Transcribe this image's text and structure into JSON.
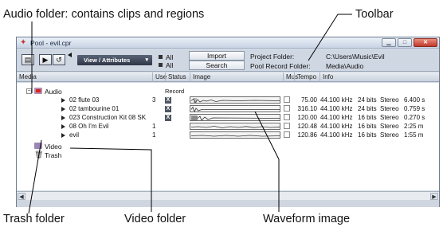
{
  "callouts": {
    "audio_folder": "Audio folder: contains clips and regions",
    "toolbar": "Toolbar",
    "trash_folder": "Trash folder",
    "video_folder": "Video folder",
    "waveform_image": "Waveform image"
  },
  "window": {
    "title": "Pool - evil.cpr",
    "buttons": {
      "minimize": "▁",
      "maximize": "□",
      "close": "✕"
    }
  },
  "toolbar": {
    "view_select": "View / Attributes",
    "all_1": "All",
    "all_2": "All",
    "import_button": "Import",
    "search_button": "Search",
    "project_folder_label": "Project Folder:",
    "project_folder_value": "C:\\Users\\Music\\Evil",
    "record_folder_label": "Pool Record Folder:",
    "record_folder_value": "Media\\Audio"
  },
  "columns": [
    "Media",
    "Use",
    "Status",
    "Image",
    "Mus",
    "Tempo",
    "Info"
  ],
  "tree": {
    "audio": {
      "label": "Audio",
      "status_header": "Record"
    },
    "video": {
      "label": "Video"
    },
    "trash": {
      "label": "Trash"
    }
  },
  "clips": [
    {
      "name": "02 flute 03",
      "use": "3",
      "status": "X",
      "tempo": "75.00",
      "rate": "44.100 kHz",
      "bits": "24 bits",
      "channels": "Stereo",
      "length": "6.400 s"
    },
    {
      "name": "02 tambourine 01",
      "use": "",
      "status": "X",
      "tempo": "316.10",
      "rate": "44.100 kHz",
      "bits": "24 bits",
      "channels": "Stereo",
      "length": "0.759 s"
    },
    {
      "name": "023 Construction Kit 08 SK",
      "use": "",
      "status": "X",
      "tempo": "120.00",
      "rate": "44.100 kHz",
      "bits": "16 bits",
      "channels": "Stereo",
      "length": "0.270 s"
    },
    {
      "name": "08 Oh I'm Evil",
      "use": "1",
      "status": "",
      "tempo": "120.48",
      "rate": "44.100 kHz",
      "bits": "16 bits",
      "channels": "Stereo",
      "length": "2:25 m"
    },
    {
      "name": "evil",
      "use": "1",
      "status": "",
      "tempo": "120.86",
      "rate": "44.100 kHz",
      "bits": "16 bits",
      "channels": "Stereo",
      "length": "1:55 m"
    }
  ],
  "colors": {
    "window_bg": "#d6dde8",
    "toolbar_bg": "#cfd7e2",
    "view_select_bg": "#2f3747",
    "status_box": "#4f5661",
    "close_button": "#c0392b"
  },
  "icons": {
    "app": "cubase-logo-icon",
    "info": "info-window-icon",
    "play": "play-icon",
    "loop": "loop-icon",
    "volume": "volume-triangle-icon",
    "expand": "tree-expand-icon",
    "audio_folder": "audio-folder-icon",
    "video_folder": "video-folder-icon",
    "trash": "trash-icon"
  }
}
